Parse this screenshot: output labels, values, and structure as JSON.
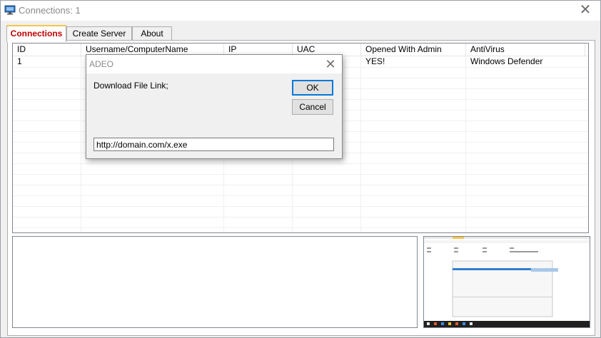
{
  "window": {
    "title": "Connections: 1",
    "close_glyph": "✕"
  },
  "tabs": [
    {
      "label": "Connections",
      "active": true
    },
    {
      "label": "Create Server",
      "active": false
    },
    {
      "label": "About",
      "active": false
    }
  ],
  "listview": {
    "columns": [
      "ID",
      "Username/ComputerName",
      "IP",
      "UAC",
      "Opened With Admin",
      "AntiVirus"
    ],
    "rows": [
      [
        "1",
        "",
        "",
        "",
        "YES!",
        "Windows Defender"
      ]
    ]
  },
  "dialog": {
    "title": "ADEO",
    "close_glyph": "✕",
    "prompt": "Download File Link;",
    "ok_label": "OK",
    "cancel_label": "Cancel",
    "input_value": "http://domain.com/x.exe"
  },
  "colors": {
    "active_tab_text": "#c00000",
    "active_tab_accent": "#f7c54a",
    "default_button_border": "#0078d7"
  },
  "icons": {
    "app": "monitor-icon",
    "preview": "screen-thumbnail"
  }
}
